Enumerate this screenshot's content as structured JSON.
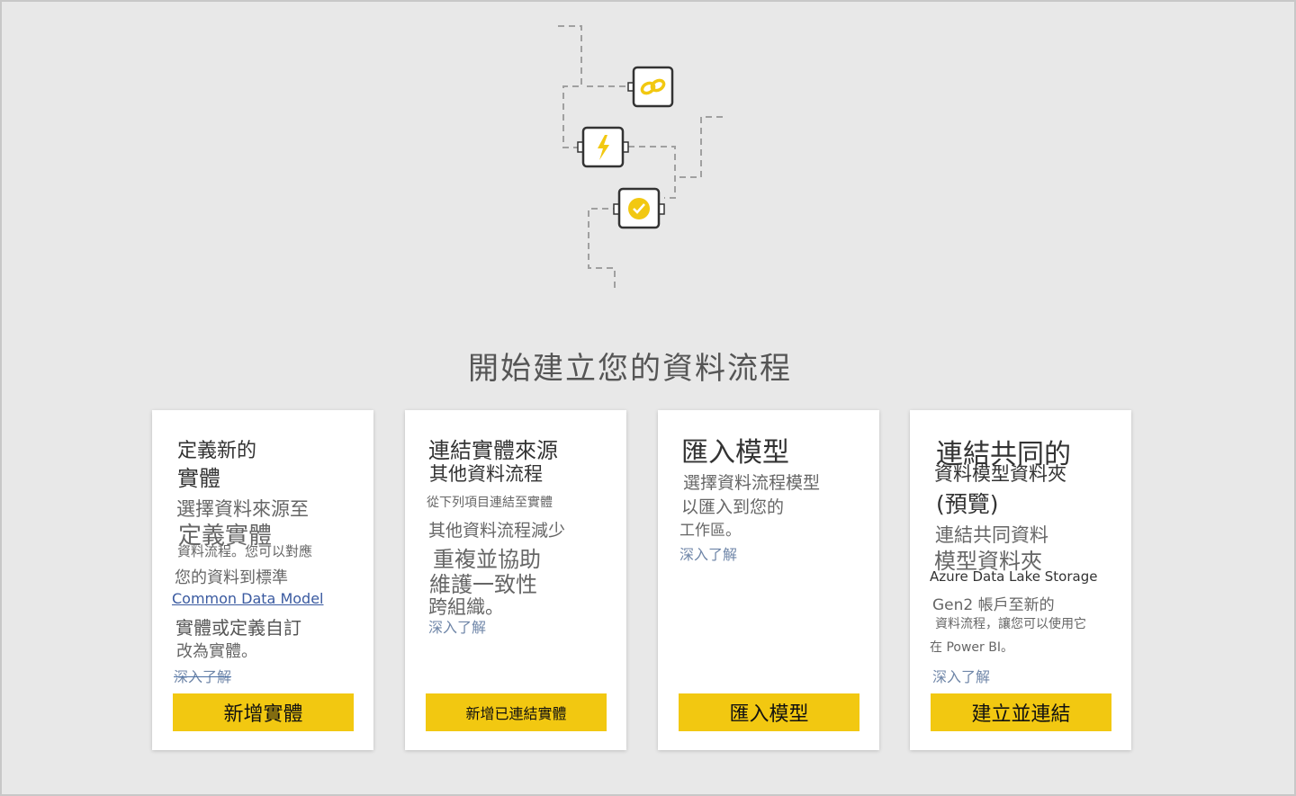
{
  "page": {
    "title": "開始建立您的資料流程"
  },
  "illustration": {
    "icons": [
      "link-icon",
      "lightning-icon",
      "verified-badge-icon"
    ],
    "accent_color": "#f2c811"
  },
  "cards": [
    {
      "title_lines": [
        "定義新的",
        "實體"
      ],
      "description_lines": [
        "選擇資料來源至",
        "定義實體",
        "資料流程。您可以對應",
        "您的資料到標準"
      ],
      "cdm_link": "Common Data Model",
      "description_after": [
        "實體或定義自訂",
        "改為實體。"
      ],
      "learn_more": "深入了解",
      "button": "新增實體"
    },
    {
      "title_lines": [
        "連結實體來源",
        "其他資料流程"
      ],
      "description_lines": [
        "從下列項目連結至實體",
        "其他資料流程減少",
        "重複並協助",
        "維護一致性",
        "跨組織。"
      ],
      "learn_more": "深入了解",
      "button": "新增已連結實體"
    },
    {
      "title_lines": [
        "匯入模型"
      ],
      "description_lines": [
        "選擇資料流程模型",
        "以匯入到您的",
        "工作區。"
      ],
      "learn_more": "深入了解",
      "button": "匯入模型"
    },
    {
      "title_lines": [
        "連結共同的",
        "資料模型資料夾",
        "(預覽)"
      ],
      "description_lines": [
        "連結共同資料",
        "模型資料夾",
        "Azure Data Lake Storage",
        "Gen2 帳戶至新的",
        "資料流程，讓您可以使用它",
        "在 Power BI。"
      ],
      "learn_more": "深入了解",
      "button": "建立並連結"
    }
  ]
}
